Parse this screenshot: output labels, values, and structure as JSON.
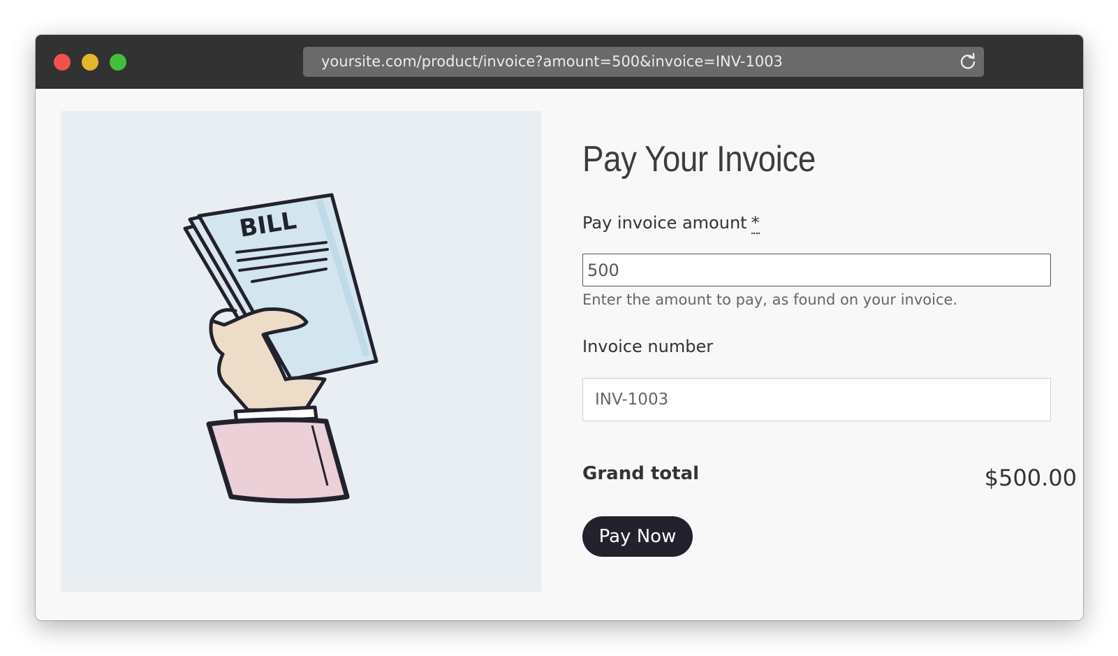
{
  "browser": {
    "url": "yoursite.com/product/invoice?amount=500&invoice=INV-1003"
  },
  "illustration": {
    "bill_text": "BILL"
  },
  "form": {
    "title": "Pay Your Invoice",
    "amount_label": "Pay invoice amount",
    "required_marker": "*",
    "amount_value": "500",
    "amount_help": "Enter the amount to pay, as found on your invoice.",
    "invoice_label": "Invoice number",
    "invoice_value": "INV-1003",
    "grand_total_label": "Grand total",
    "grand_total_value": "$500.00",
    "pay_button_label": "Pay Now"
  },
  "colors": {
    "button_bg": "#22222e",
    "titlebar_bg": "#323232",
    "close_dot": "#f5504f",
    "minimize_dot": "#e3b72b",
    "maximize_dot": "#43c03a"
  }
}
